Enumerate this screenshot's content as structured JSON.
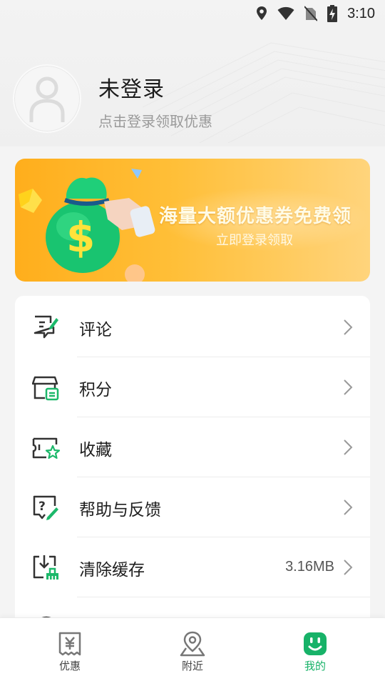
{
  "status_bar": {
    "time": "3:10",
    "icons": [
      "location-icon",
      "wifi-icon",
      "no-sim-icon",
      "battery-charging-icon"
    ]
  },
  "profile": {
    "name": "未登录",
    "subtitle": "点击登录领取优惠",
    "avatar_icon": "user-placeholder-icon"
  },
  "banner": {
    "title": "海量大额优惠券免费领",
    "subtitle": "立即登录领取",
    "colors": {
      "start": "#ffae1c",
      "end": "#ffd47c"
    }
  },
  "menu": {
    "items": [
      {
        "label": "评论",
        "icon": "comment-edit-icon",
        "value": ""
      },
      {
        "label": "积分",
        "icon": "points-store-icon",
        "value": ""
      },
      {
        "label": "收藏",
        "icon": "favorite-ticket-icon",
        "value": ""
      },
      {
        "label": "帮助与反馈",
        "icon": "help-feedback-icon",
        "value": ""
      },
      {
        "label": "清除缓存",
        "icon": "clear-cache-icon",
        "value": "3.16MB"
      }
    ]
  },
  "tab_bar": {
    "tabs": [
      {
        "label": "优惠",
        "icon": "coupon-yen-icon",
        "active": false
      },
      {
        "label": "附近",
        "icon": "nearby-location-icon",
        "active": false
      },
      {
        "label": "我的",
        "icon": "my-smile-icon",
        "active": true
      }
    ],
    "accent_color": "#17b268"
  }
}
